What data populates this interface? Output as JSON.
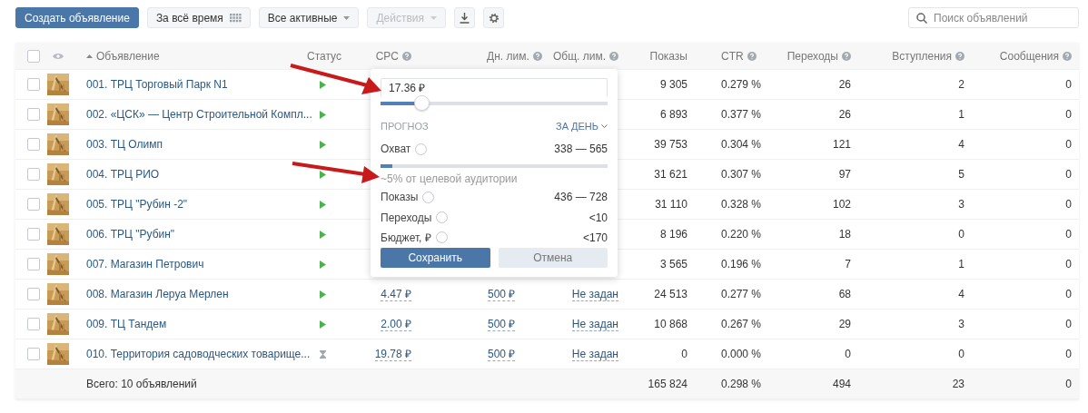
{
  "toolbar": {
    "create_button": "Создать объявление",
    "period_button": "За всё время",
    "filter_dropdown": "Все активные",
    "actions_dropdown": {
      "label": "Действия",
      "disabled": true
    },
    "search": {
      "placeholder": "Поиск объявлений"
    }
  },
  "table": {
    "header_checkbox": {
      "checked": false
    },
    "columns": [
      {
        "label": "Объявление",
        "help": false,
        "sorted": true
      },
      {
        "label": "Статус",
        "help": false,
        "sorted": false
      },
      {
        "label": "CPC",
        "help": true,
        "sorted": false
      },
      {
        "label": "Дн. лим.",
        "help": true,
        "sorted": false
      },
      {
        "label": "Общ. лим.",
        "help": true,
        "sorted": false
      },
      {
        "label": "Показы",
        "help": false,
        "sorted": false
      },
      {
        "label": "CTR",
        "help": true,
        "sorted": false
      },
      {
        "label": "Переходы",
        "help": true,
        "sorted": false
      },
      {
        "label": "Вступления",
        "help": true,
        "sorted": false
      },
      {
        "label": "Сообщения",
        "help": true,
        "sorted": false
      }
    ],
    "rows": [
      {
        "checked": false,
        "name": "001. ТРЦ Торговый Парк N1",
        "kind": "active",
        "impressions": "9 305",
        "ctr": "0.279 %",
        "clicks": "26",
        "joins": "2",
        "messages": "0"
      },
      {
        "checked": false,
        "name": "002. «ЦСК» — Центр Строительной Компл...",
        "kind": "active",
        "impressions": "6 893",
        "ctr": "0.377 %",
        "clicks": "26",
        "joins": "1",
        "messages": "0"
      },
      {
        "checked": false,
        "name": "003. ТЦ Олимп",
        "kind": "active",
        "impressions": "39 753",
        "ctr": "0.304 %",
        "clicks": "121",
        "joins": "4",
        "messages": "0"
      },
      {
        "checked": false,
        "name": "004. ТРЦ РИО",
        "kind": "active",
        "impressions": "31 621",
        "ctr": "0.307 %",
        "clicks": "97",
        "joins": "5",
        "messages": "0"
      },
      {
        "checked": false,
        "name": "005. ТРЦ \"Рубин -2\"",
        "kind": "active",
        "impressions": "31 110",
        "ctr": "0.328 %",
        "clicks": "102",
        "joins": "3",
        "messages": "0"
      },
      {
        "checked": false,
        "name": "006. ТРЦ \"Рубин\"",
        "kind": "active",
        "impressions": "8 196",
        "ctr": "0.220 %",
        "clicks": "18",
        "joins": "0",
        "messages": "0"
      },
      {
        "checked": false,
        "name": "007. Магазин Петрович",
        "kind": "active",
        "impressions": "3 565",
        "ctr": "0.196 %",
        "clicks": "7",
        "joins": "1",
        "messages": "0"
      },
      {
        "checked": false,
        "name": "008. Магазин Леруа Мерлен",
        "kind": "active",
        "cpc": "4.47 ₽",
        "day_limit": "500 ₽",
        "total_limit": "Не задан",
        "impressions": "24 513",
        "ctr": "0.277 %",
        "clicks": "68",
        "joins": "4",
        "messages": "0"
      },
      {
        "checked": false,
        "name": "009. ТЦ Тандем",
        "kind": "active",
        "cpc": "2.00 ₽",
        "day_limit": "500 ₽",
        "total_limit": "Не задан",
        "impressions": "10 868",
        "ctr": "0.267 %",
        "clicks": "29",
        "joins": "3",
        "messages": "0"
      },
      {
        "checked": false,
        "name": "010. Территория садоводческих товарище...",
        "kind": "pending",
        "cpc": "19.78 ₽",
        "day_limit": "500 ₽",
        "total_limit": "Не задан",
        "impressions": "0",
        "ctr": "0.000 %",
        "clicks": "0",
        "joins": "0",
        "messages": "0"
      }
    ],
    "total": {
      "label": "Всего: 10 объявлений",
      "impressions": "165 824",
      "ctr": "0.298 %",
      "clicks": "494",
      "joins": "23",
      "messages": "0"
    }
  },
  "popup": {
    "value": "17.36 ₽",
    "level": 0.18,
    "forecast_label": "ПРОГНОЗ",
    "period": "ЗА ДЕНЬ",
    "reach": {
      "label": "Охват",
      "value": "338 — 565",
      "level": 0.05,
      "note": "~5% от целевой аудитории"
    },
    "metrics": [
      {
        "label": "Показы",
        "value": "436 — 728"
      },
      {
        "label": "Переходы",
        "value": "<10"
      },
      {
        "label": "Бюджет, ₽",
        "value": "<170"
      }
    ],
    "save_button": "Сохранить",
    "cancel_button": "Отмена"
  }
}
